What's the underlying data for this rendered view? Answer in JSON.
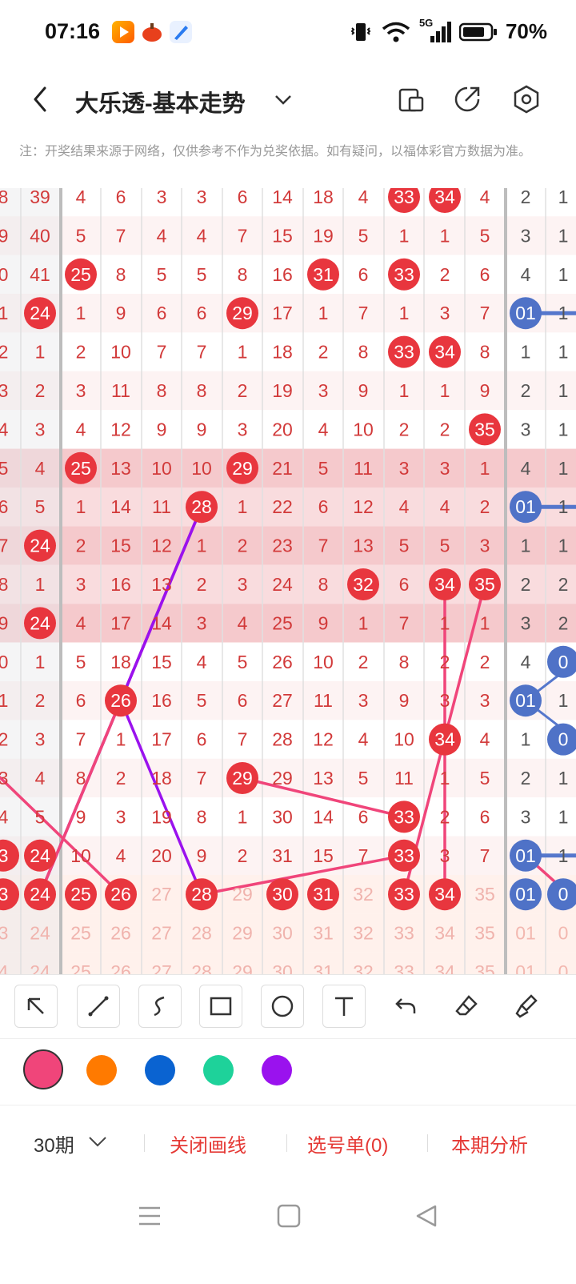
{
  "status": {
    "time": "07:16",
    "network": "5G",
    "battery": "70%"
  },
  "header": {
    "title": "大乐透-基本走势"
  },
  "notice": "注：开奖结果来源于网络，仅供参考不作为兑奖依据。如有疑问，以福体彩官方数据为准。",
  "grid": {
    "rows": [
      {
        "c": [
          "8",
          "39",
          "4",
          "6",
          "3",
          "3",
          "6",
          "14",
          "18",
          "4",
          "33",
          "34",
          "4",
          "2",
          "1"
        ],
        "hl": [
          10,
          11
        ]
      },
      {
        "c": [
          "9",
          "40",
          "5",
          "7",
          "4",
          "4",
          "7",
          "15",
          "19",
          "5",
          "1",
          "1",
          "5",
          "3",
          "1"
        ],
        "hl": []
      },
      {
        "c": [
          "0",
          "41",
          "25",
          "8",
          "5",
          "5",
          "8",
          "16",
          "31",
          "6",
          "33",
          "2",
          "6",
          "4",
          "1"
        ],
        "hl": [
          2,
          8,
          10
        ]
      },
      {
        "c": [
          "1",
          "24",
          "1",
          "9",
          "6",
          "6",
          "29",
          "17",
          "1",
          "7",
          "1",
          "3",
          "7",
          "01",
          "1"
        ],
        "hl": [
          1,
          6
        ],
        "bl": [
          13
        ]
      },
      {
        "c": [
          "2",
          "1",
          "2",
          "10",
          "7",
          "7",
          "1",
          "18",
          "2",
          "8",
          "33",
          "34",
          "8",
          "1",
          "1"
        ],
        "hl": [
          10,
          11
        ]
      },
      {
        "c": [
          "3",
          "2",
          "3",
          "11",
          "8",
          "8",
          "2",
          "19",
          "3",
          "9",
          "1",
          "1",
          "9",
          "2",
          "1"
        ],
        "hl": []
      },
      {
        "c": [
          "4",
          "3",
          "4",
          "12",
          "9",
          "9",
          "3",
          "20",
          "4",
          "10",
          "2",
          "2",
          "35",
          "3",
          "1"
        ],
        "hl": [
          12
        ]
      },
      {
        "c": [
          "5",
          "4",
          "25",
          "13",
          "10",
          "10",
          "29",
          "21",
          "5",
          "11",
          "3",
          "3",
          "1",
          "4",
          "1"
        ],
        "hl": [
          2,
          6
        ]
      },
      {
        "c": [
          "6",
          "5",
          "1",
          "14",
          "11",
          "28",
          "1",
          "22",
          "6",
          "12",
          "4",
          "4",
          "2",
          "01",
          "1"
        ],
        "hl": [
          5
        ],
        "bl": [
          13
        ]
      },
      {
        "c": [
          "7",
          "24",
          "2",
          "15",
          "12",
          "1",
          "2",
          "23",
          "7",
          "13",
          "5",
          "5",
          "3",
          "1",
          "1"
        ],
        "hl": [
          1
        ]
      },
      {
        "c": [
          "8",
          "1",
          "3",
          "16",
          "13",
          "2",
          "3",
          "24",
          "8",
          "32",
          "6",
          "34",
          "35",
          "2",
          "2"
        ],
        "hl": [
          9,
          11,
          12
        ]
      },
      {
        "c": [
          "9",
          "24",
          "4",
          "17",
          "14",
          "3",
          "4",
          "25",
          "9",
          "1",
          "7",
          "1",
          "1",
          "3",
          "2"
        ],
        "hl": [
          1
        ]
      },
      {
        "c": [
          "0",
          "1",
          "5",
          "18",
          "15",
          "4",
          "5",
          "26",
          "10",
          "2",
          "8",
          "2",
          "2",
          "4",
          "0"
        ],
        "hl": [],
        "bl": [
          14
        ]
      },
      {
        "c": [
          "1",
          "2",
          "6",
          "26",
          "16",
          "5",
          "6",
          "27",
          "11",
          "3",
          "9",
          "3",
          "3",
          "01",
          "1"
        ],
        "hl": [
          3
        ],
        "bl": [
          13
        ]
      },
      {
        "c": [
          "2",
          "3",
          "7",
          "1",
          "17",
          "6",
          "7",
          "28",
          "12",
          "4",
          "10",
          "34",
          "4",
          "1",
          "0"
        ],
        "hl": [
          11
        ],
        "bl": [
          14
        ]
      },
      {
        "c": [
          "3",
          "4",
          "8",
          "2",
          "18",
          "7",
          "29",
          "29",
          "13",
          "5",
          "11",
          "1",
          "5",
          "2",
          "1"
        ],
        "hl": [
          6
        ]
      },
      {
        "c": [
          "4",
          "5",
          "9",
          "3",
          "19",
          "8",
          "1",
          "30",
          "14",
          "6",
          "33",
          "2",
          "6",
          "3",
          "1"
        ],
        "hl": [
          10
        ]
      },
      {
        "c": [
          "3",
          "24",
          "10",
          "4",
          "20",
          "9",
          "2",
          "31",
          "15",
          "7",
          "33",
          "3",
          "7",
          "01",
          "1"
        ],
        "hl": [
          0,
          1,
          10
        ],
        "bl": [
          13
        ]
      },
      {
        "c": [
          "3",
          "24",
          "25",
          "26",
          "27",
          "28",
          "29",
          "30",
          "31",
          "32",
          "33",
          "34",
          "35",
          "01",
          "0"
        ],
        "hl": [
          0,
          1,
          2,
          3,
          5,
          7,
          8,
          10,
          11
        ],
        "bl": [
          13,
          14
        ]
      },
      {
        "c": [
          "3",
          "24",
          "25",
          "26",
          "27",
          "28",
          "29",
          "30",
          "31",
          "32",
          "33",
          "34",
          "35",
          "01",
          "0"
        ],
        "hl": [],
        "dim": true
      },
      {
        "c": [
          "4",
          "24",
          "25",
          "26",
          "27",
          "28",
          "29",
          "30",
          "31",
          "32",
          "33",
          "34",
          "35",
          "01",
          "0"
        ],
        "hl": [],
        "dim": true
      }
    ]
  },
  "palette": {
    "colors": [
      "#f0457a",
      "#ff7a00",
      "#0a63d1",
      "#1ed29a",
      "#9a12ee"
    ]
  },
  "bottom": {
    "period": "30期",
    "close_lines": "关闭画线",
    "selection": "选号单(0)",
    "analysis": "本期分析"
  }
}
